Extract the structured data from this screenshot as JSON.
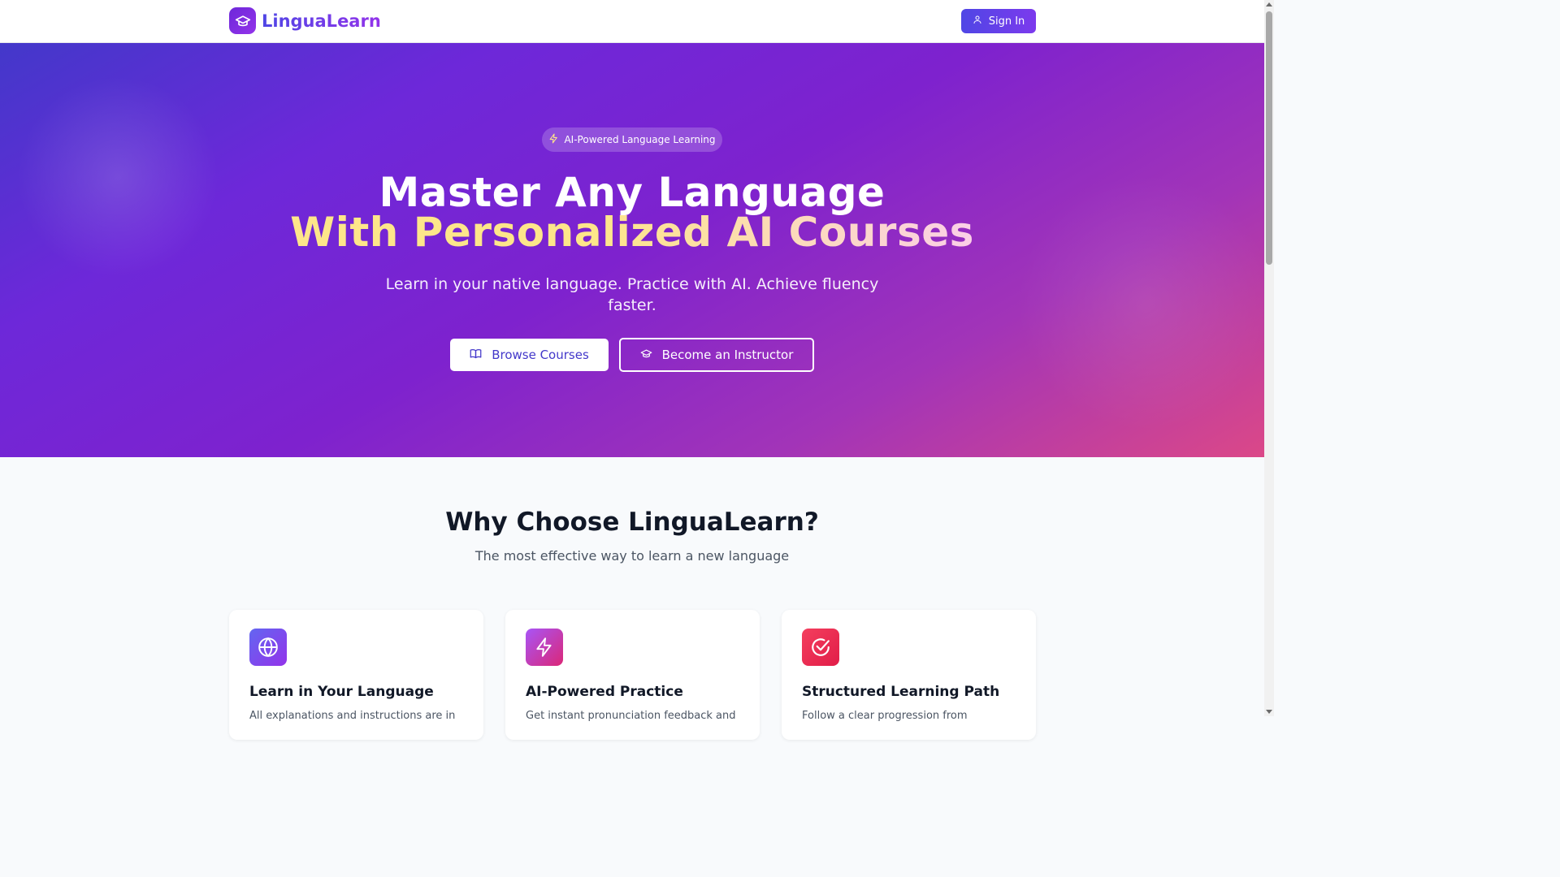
{
  "header": {
    "brand_name": "LinguaLearn",
    "signin_label": "Sign In"
  },
  "hero": {
    "badge": "AI-Powered Language Learning",
    "headline_line1": "Master Any Language",
    "headline_line2": "With Personalized AI Courses",
    "subtitle": "Learn in your native language. Practice with AI. Achieve fluency faster.",
    "browse_label": "Browse Courses",
    "instructor_label": "Become an Instructor"
  },
  "why": {
    "title": "Why Choose LinguaLearn?",
    "subtitle": "The most effective way to learn a new language",
    "cards": [
      {
        "icon": "globe-icon",
        "title": "Learn in Your Language",
        "desc": "All explanations and instructions are in",
        "color": "#7c3aed"
      },
      {
        "icon": "lightning-icon",
        "title": "AI-Powered Practice",
        "desc": "Get instant pronunciation feedback and",
        "color": "#c026d3"
      },
      {
        "icon": "check-circle-icon",
        "title": "Structured Learning Path",
        "desc": "Follow a clear progression from",
        "color": "#e11d48"
      }
    ]
  },
  "colors": {
    "brand": "#7c3aed",
    "hero_start": "#4338ca",
    "hero_end": "#db4888",
    "accent_yellow": "#fde68a"
  }
}
